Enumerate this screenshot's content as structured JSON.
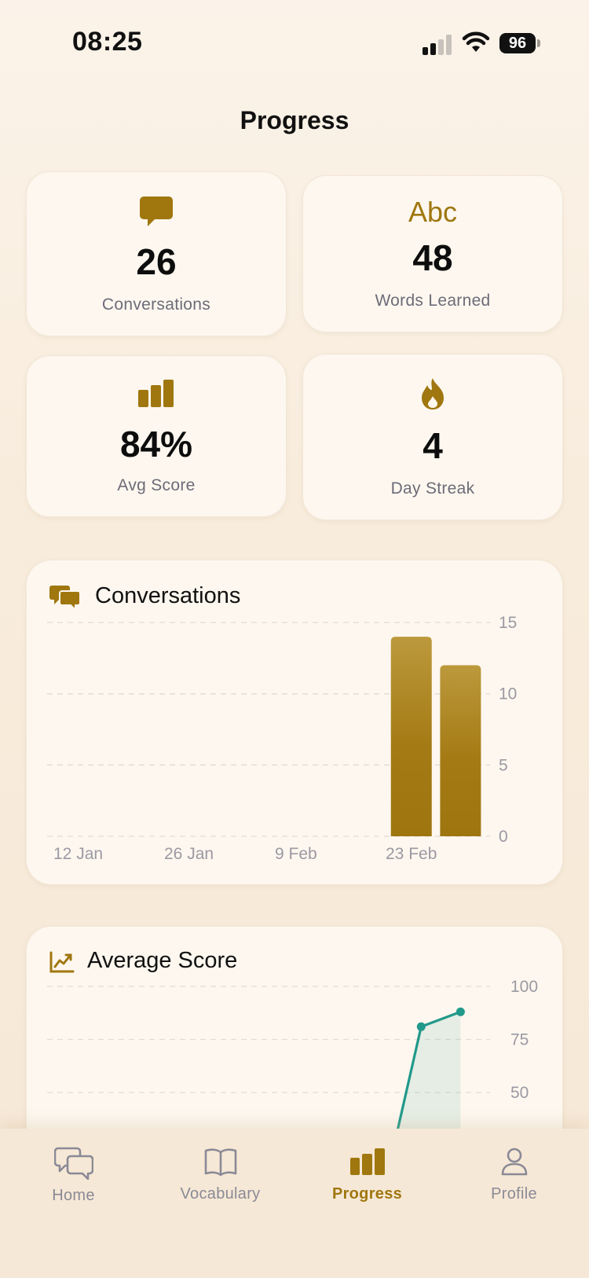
{
  "status_bar": {
    "time": "08:25",
    "battery": "96"
  },
  "page": {
    "title": "Progress"
  },
  "stats": [
    {
      "icon": "chat-bubble-icon",
      "value": "26",
      "label": "Conversations"
    },
    {
      "icon": "abc-text-icon",
      "icon_text": "Abc",
      "value": "48",
      "label": "Words Learned"
    },
    {
      "icon": "bar-chart-icon",
      "value": "84%",
      "label": "Avg Score"
    },
    {
      "icon": "flame-icon",
      "value": "4",
      "label": "Day Streak"
    }
  ],
  "colors": {
    "accent": "#a0770f",
    "line": "#21998a",
    "label": "#6c6c78",
    "card": "#fdf7ef"
  },
  "chart_data": [
    {
      "type": "bar",
      "title": "Conversations",
      "x_tick_labels": [
        "12 Jan",
        "26 Jan",
        "9 Feb",
        "23 Feb"
      ],
      "y_ticks": [
        "0",
        "5",
        "10",
        "15"
      ],
      "ylim": [
        0,
        15
      ],
      "x_domain_days": [
        0,
        45
      ],
      "bars": [
        {
          "day": 37,
          "value": 14
        },
        {
          "day": 42,
          "value": 12
        }
      ],
      "grid": true,
      "y_axis_position": "right"
    },
    {
      "type": "line",
      "title": "Average Score",
      "y_ticks": [
        "50",
        "75",
        "100"
      ],
      "ylim": [
        0,
        100
      ],
      "points": [
        {
          "day": 35,
          "value": 20
        },
        {
          "day": 38,
          "value": 81
        },
        {
          "day": 42,
          "value": 88
        }
      ],
      "area_fill": true,
      "grid": true,
      "y_axis_position": "right"
    }
  ],
  "tabs": [
    {
      "label": "Home",
      "icon": "chat-bubbles-icon",
      "active": false
    },
    {
      "label": "Vocabulary",
      "icon": "book-icon",
      "active": false
    },
    {
      "label": "Progress",
      "icon": "bar-chart-icon",
      "active": true
    },
    {
      "label": "Profile",
      "icon": "person-icon",
      "active": false
    }
  ]
}
